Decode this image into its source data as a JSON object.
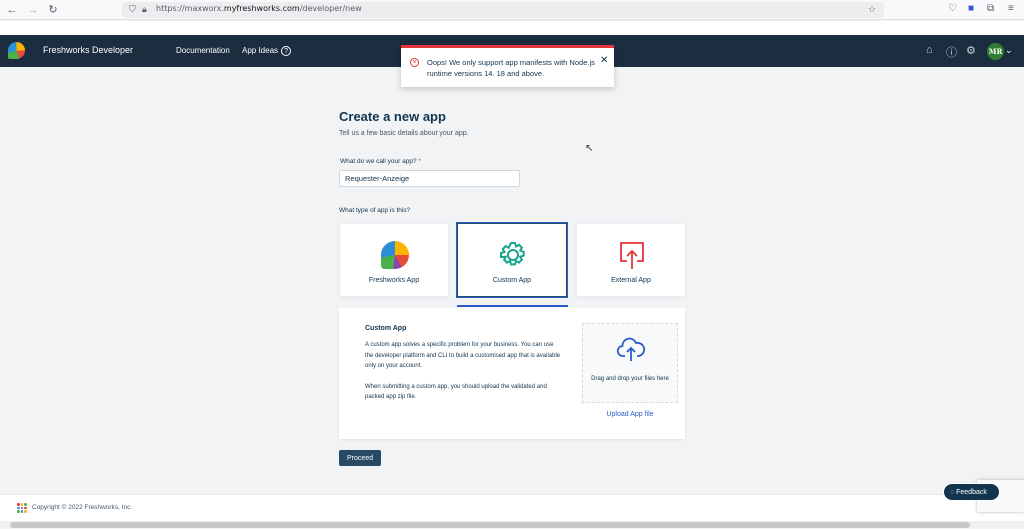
{
  "browser": {
    "url_prefix": "https://maxworx.",
    "url_domain": "myfreshworks.com",
    "url_path": "/developer/new"
  },
  "header": {
    "brand": "Freshworks Developer",
    "nav": [
      "Documentation",
      "App Ideas"
    ],
    "avatar_initials": "MR",
    "bg_color": "#1b2d3f"
  },
  "toast": {
    "message": "Oops! We only support app manifests with Node.js runtime versions 14. 18 and above.",
    "close": "✕",
    "accent_color": "#e43538"
  },
  "form": {
    "title": "Create a new app",
    "subtitle": "Tell us a few basic details about your app.",
    "name_label": "What do we call your app?",
    "name_required": "*",
    "name_value": "Requester-Anzeige",
    "type_label": "What type of app is this?",
    "types": [
      {
        "label": "Freshworks App",
        "icon": "freshworks-logo-icon",
        "selected": false
      },
      {
        "label": "Custom App",
        "icon": "gear-icon",
        "selected": true
      },
      {
        "label": "External App",
        "icon": "upload-external-icon",
        "selected": false
      }
    ],
    "detail": {
      "title": "Custom App",
      "para1": "A custom app solves a specific problem for your business. You can use the developer platform and CLI to build a customised app that is available only on your account.",
      "para2": "When submitting a custom app, you should upload the validated and packed app zip file.",
      "dropzone_text": "Drag and drop your files here",
      "upload_link": "Upload App file"
    },
    "proceed_label": "Proceed"
  },
  "footer": {
    "copyright": "Copyright © 2022 Freshworks, Inc.",
    "feedback": "Feedback"
  }
}
